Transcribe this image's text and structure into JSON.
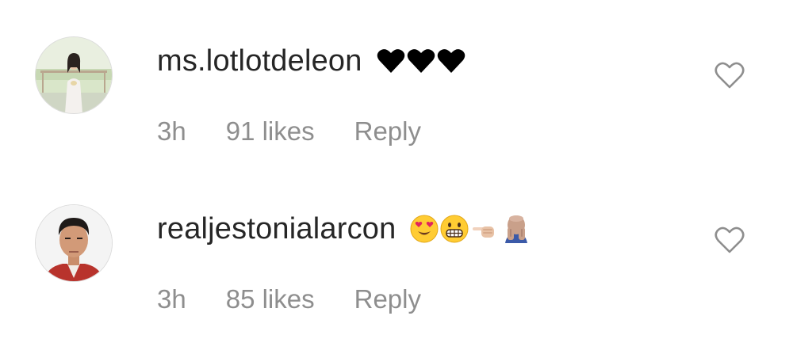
{
  "comments": [
    {
      "username": "ms.lotlotdeleon",
      "emoji": [
        "black-heart",
        "black-heart",
        "black-heart"
      ],
      "time": "3h",
      "likes": "91 likes",
      "reply_label": "Reply"
    },
    {
      "username": "realjestonialarcon",
      "emoji": [
        "heart-eyes-face",
        "grimacing-face",
        "pointing-hand-light-skin",
        "bald-man-facepalm"
      ],
      "time": "3h",
      "likes": "85 likes",
      "reply_label": "Reply"
    }
  ],
  "colors": {
    "username": "#262626",
    "meta": "#8e8e8e",
    "heart_outline": "#8e8e8e",
    "black_heart": "#000000"
  }
}
